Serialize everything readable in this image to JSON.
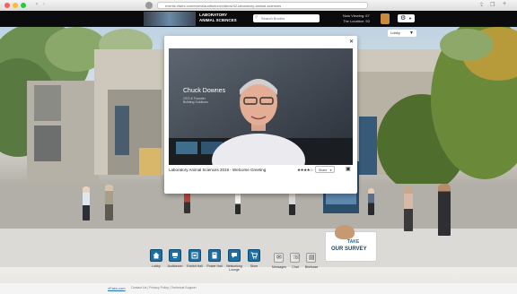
{
  "browser": {
    "url": "events.vfairs.com/event/auditorium/videos/42-laboratory-animal-sciences"
  },
  "header": {
    "logo_line1": "LABORATORY",
    "logo_line2": "ANIMAL SCIENCES",
    "search_placeholder": "Search Booths",
    "now_viewing_label": "Now Viewing:",
    "now_viewing_value": "67",
    "location_label": "The Location:",
    "location_value": "53"
  },
  "scene": {
    "lobby_label": "Lobby"
  },
  "modal": {
    "video_name": "Chuck Downes",
    "video_title_line1": "CEO & Founder",
    "video_title_line2": "Building Solutions",
    "caption": "Laboratory Animal Sciences 2019 - Welcome Greeting",
    "rating": "★★★★☆",
    "share_label": "Share",
    "close_symbol": "✕"
  },
  "survey": {
    "line1": "TAKE",
    "line2": "OUR SURVEY"
  },
  "nav": {
    "items": [
      {
        "label": "Lobby",
        "icon": "home-icon"
      },
      {
        "label": "Auditorium",
        "icon": "auditorium-icon"
      },
      {
        "label": "Exhibit Hall",
        "icon": "exhibit-hall-icon"
      },
      {
        "label": "Poster Hall",
        "icon": "poster-hall-icon"
      },
      {
        "label": "Networking Lounge",
        "icon": "networking-icon"
      },
      {
        "label": "Store",
        "icon": "store-icon"
      }
    ],
    "secondary": [
      {
        "label": "Messages",
        "icon": "messages-icon"
      },
      {
        "label": "Chat",
        "icon": "chat-icon"
      },
      {
        "label": "Briefcase",
        "icon": "briefcase-icon"
      }
    ]
  },
  "footer": {
    "brand": "vFairs.com",
    "links": "Contact Us  |  Privacy Policy  |  Technical Support"
  },
  "colors": {
    "nav_button": "#1d6fa3",
    "header": "#0b0b0e",
    "survey_accent": "#2b6c9a"
  }
}
